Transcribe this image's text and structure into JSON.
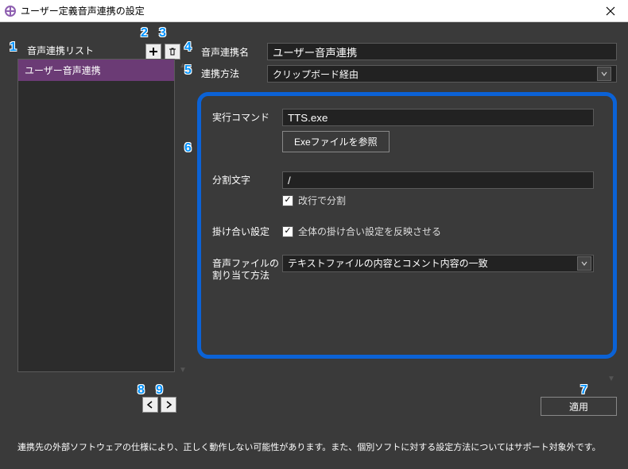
{
  "window": {
    "title": "ユーザー定義音声連携の設定"
  },
  "sidebar": {
    "heading": "音声連携リスト",
    "items": [
      {
        "label": "ユーザー音声連携",
        "selected": true
      }
    ]
  },
  "form": {
    "name_label": "音声連携名",
    "name_value": "ユーザー音声連携",
    "method_label": "連携方法",
    "method_value": "クリップボード経由"
  },
  "settings": {
    "cmd_label": "実行コマンド",
    "cmd_value": "TTS.exe",
    "browse_label": "Exeファイルを参照",
    "split_label": "分割文字",
    "split_value": "/",
    "split_checkbox_label": "改行で分割",
    "split_checked": true,
    "kakeai_label": "掛け合い設定",
    "kakeai_checkbox_label": "全体の掛け合い設定を反映させる",
    "kakeai_checked": true,
    "assign_label": "音声ファイルの割り当て方法",
    "assign_value": "テキストファイルの内容とコメント内容の一致"
  },
  "footer": {
    "apply_label": "適用",
    "note": "連携先の外部ソフトウェアの仕様により、正しく動作しない可能性があります。また、個別ソフトに対する設定方法についてはサポート対象外です。"
  },
  "badges": {
    "1": "1",
    "2": "2",
    "3": "3",
    "4": "4",
    "5": "5",
    "6": "6",
    "7": "7",
    "8": "8",
    "9": "9"
  }
}
